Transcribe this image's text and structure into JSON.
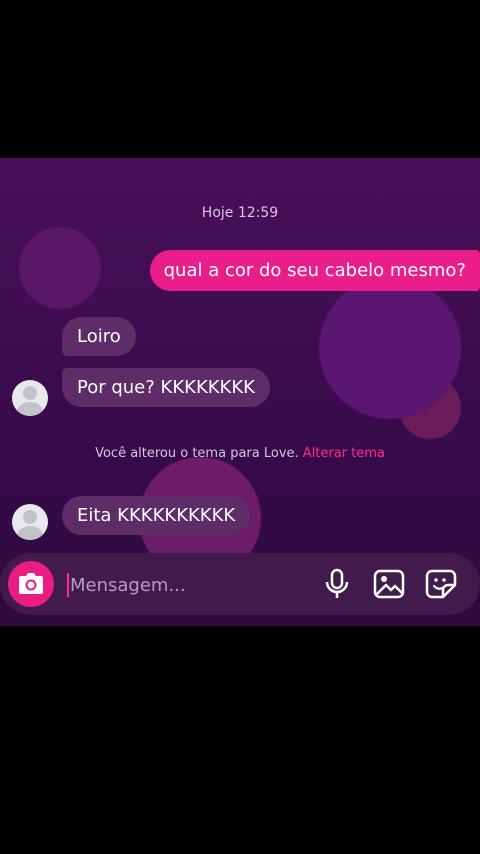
{
  "chat": {
    "timestamp": "Hoje 12:59",
    "messages": [
      {
        "from": "me",
        "text": "qual a cor do seu cabelo mesmo?"
      },
      {
        "from": "them",
        "text": "Loiro"
      },
      {
        "from": "them",
        "text": "Por que? KKKKKKKK"
      },
      {
        "from": "them",
        "text": "Eita KKKKKKKKKK"
      }
    ],
    "system_notice": {
      "text": "Você alterou o tema para Love.",
      "link": "Alterar tema"
    }
  },
  "composer": {
    "placeholder": "Mensagem...",
    "icons": [
      "camera-icon",
      "microphone-icon",
      "gallery-icon",
      "sticker-icon"
    ]
  },
  "colors": {
    "accent": "#e91e8a",
    "received_bubble": "#5e2c66",
    "background": "#3a0b4d"
  }
}
